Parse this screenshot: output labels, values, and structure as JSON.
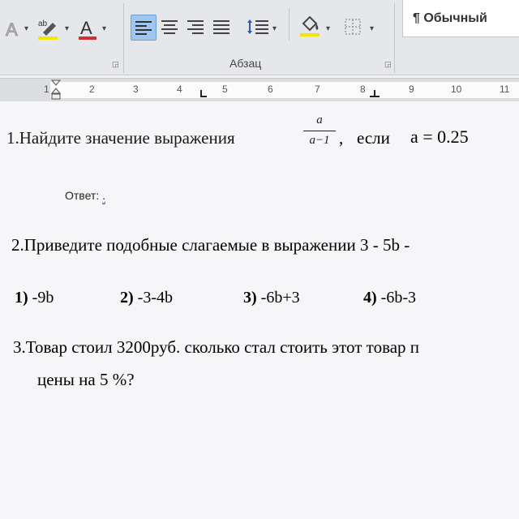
{
  "ribbon": {
    "style_name": "¶ Обычный",
    "group_label": "Абзац",
    "style_partial": "¶ Обычный ¶"
  },
  "ruler": {
    "numbers": [
      "1",
      "2",
      "3",
      "4",
      "5",
      "6",
      "7",
      "8",
      "9",
      "10",
      "11"
    ]
  },
  "document": {
    "q1": {
      "text": "1.Найдите значение выражения",
      "frac_num": "a",
      "frac_den": "a−1",
      "comma": ",",
      "if_word": "если",
      "condition": "a = 0.25"
    },
    "answer_label": "Ответ:",
    "answer_mark": ".",
    "q2": {
      "text": "2.Приведите подобные слагаемые в выражении   3 - 5b -",
      "options": [
        {
          "num": "1)",
          "val": "-9b"
        },
        {
          "num": "2)",
          "val": "-3-4b"
        },
        {
          "num": "3)",
          "val": "-6b+3"
        },
        {
          "num": "4)",
          "val": "-6b-3"
        }
      ]
    },
    "q3": {
      "line1": "3.Товар стоил 3200руб. сколько стал стоить этот товар п",
      "line2": "цены на 5 %?"
    }
  },
  "colors": {
    "font_color_bar": "#d32f2f",
    "highlight_bar": "#f2e600",
    "active_align": "#9ec6ef"
  }
}
